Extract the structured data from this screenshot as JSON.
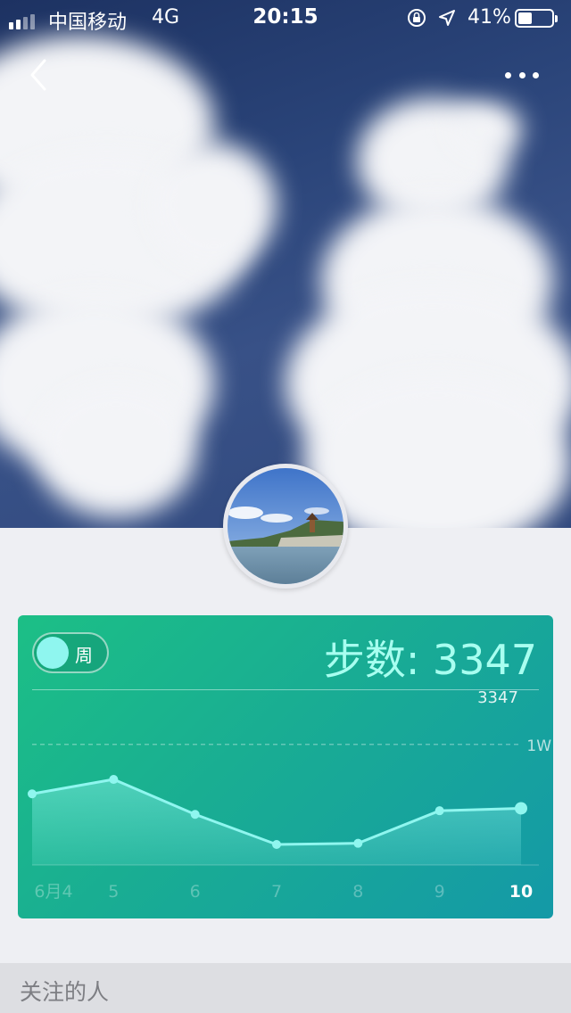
{
  "status_bar": {
    "carrier": "中国移动",
    "network": "4G",
    "time": "20:15",
    "battery": "41%",
    "battery_level": 0.41
  },
  "nav": {
    "back_icon": "chevron-left-icon",
    "more_icon": "more-dots-icon"
  },
  "card": {
    "toggle_label": "周",
    "steps_title": "步数: 3347",
    "colors": {
      "start": "#1cbf86",
      "end": "#1499a7",
      "line": "#8ff6ef",
      "text": "#a8fff0"
    }
  },
  "chart_data": {
    "type": "area",
    "categories": [
      "6月4",
      "5",
      "6",
      "7",
      "8",
      "9",
      "10"
    ],
    "values": [
      5900,
      7100,
      4200,
      1700,
      1800,
      4500,
      4700
    ],
    "highlight_label": "3347",
    "reference_line": {
      "value": 10000,
      "label": "1W"
    },
    "ylim": [
      0,
      14500
    ],
    "grid": false
  },
  "follow_section": {
    "title": "关注的人"
  }
}
